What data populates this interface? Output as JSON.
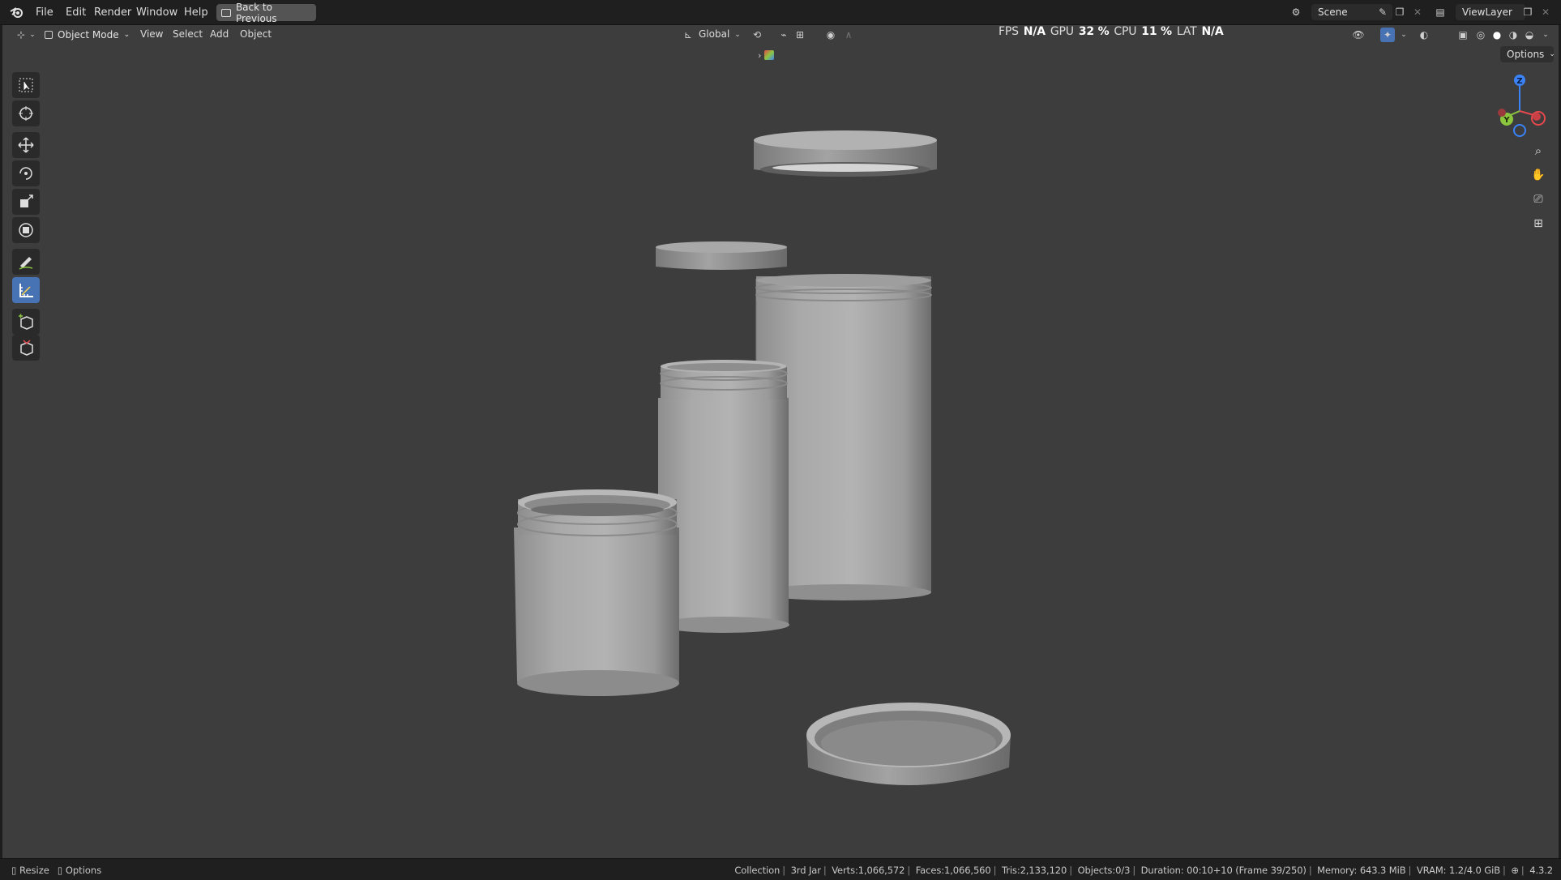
{
  "topbar": {
    "menus": [
      "File",
      "Edit",
      "Render",
      "Window",
      "Help"
    ],
    "back_button": "Back to Previous",
    "scene_name": "Scene",
    "view_layer": "ViewLayer"
  },
  "header": {
    "mode": "Object Mode",
    "menus": [
      "View",
      "Select",
      "Add",
      "Object"
    ],
    "orientation": "Global",
    "options": "Options"
  },
  "overlay_stats": {
    "fps_label": "FPS",
    "fps_value": "N/A",
    "gpu_label": "GPU",
    "gpu_value": "32 %",
    "cpu_label": "CPU",
    "cpu_value": "11 %",
    "lat_label": "LAT",
    "lat_value": "N/A"
  },
  "gizmo": {
    "z": "Z",
    "y": "Y",
    "colors": {
      "x": "#e5484d",
      "y": "#8cc63f",
      "z": "#3b82f6"
    }
  },
  "toolbar": {
    "tools": [
      "select-box",
      "cursor",
      "move",
      "rotate",
      "scale",
      "transform",
      "annotate",
      "measure",
      "add-cube",
      "extrude"
    ],
    "active": "measure"
  },
  "statusbar": {
    "left": {
      "resize": "Resize",
      "options": "Options"
    },
    "collection": "Collection",
    "object": "3rd Jar",
    "verts": "Verts:1,066,572",
    "faces": "Faces:1,066,560",
    "tris": "Tris:2,133,120",
    "objects": "Objects:0/3",
    "duration": "Duration: 00:10+10 (Frame 39/250)",
    "memory": "Memory: 643.3 MiB",
    "vram": "VRAM: 1.2/4.0 GiB",
    "version": "4.3.2"
  },
  "colors": {
    "viewport_bg": "#3d3d3d",
    "accent": "#4772b3",
    "panel": "#1f1f1f"
  }
}
